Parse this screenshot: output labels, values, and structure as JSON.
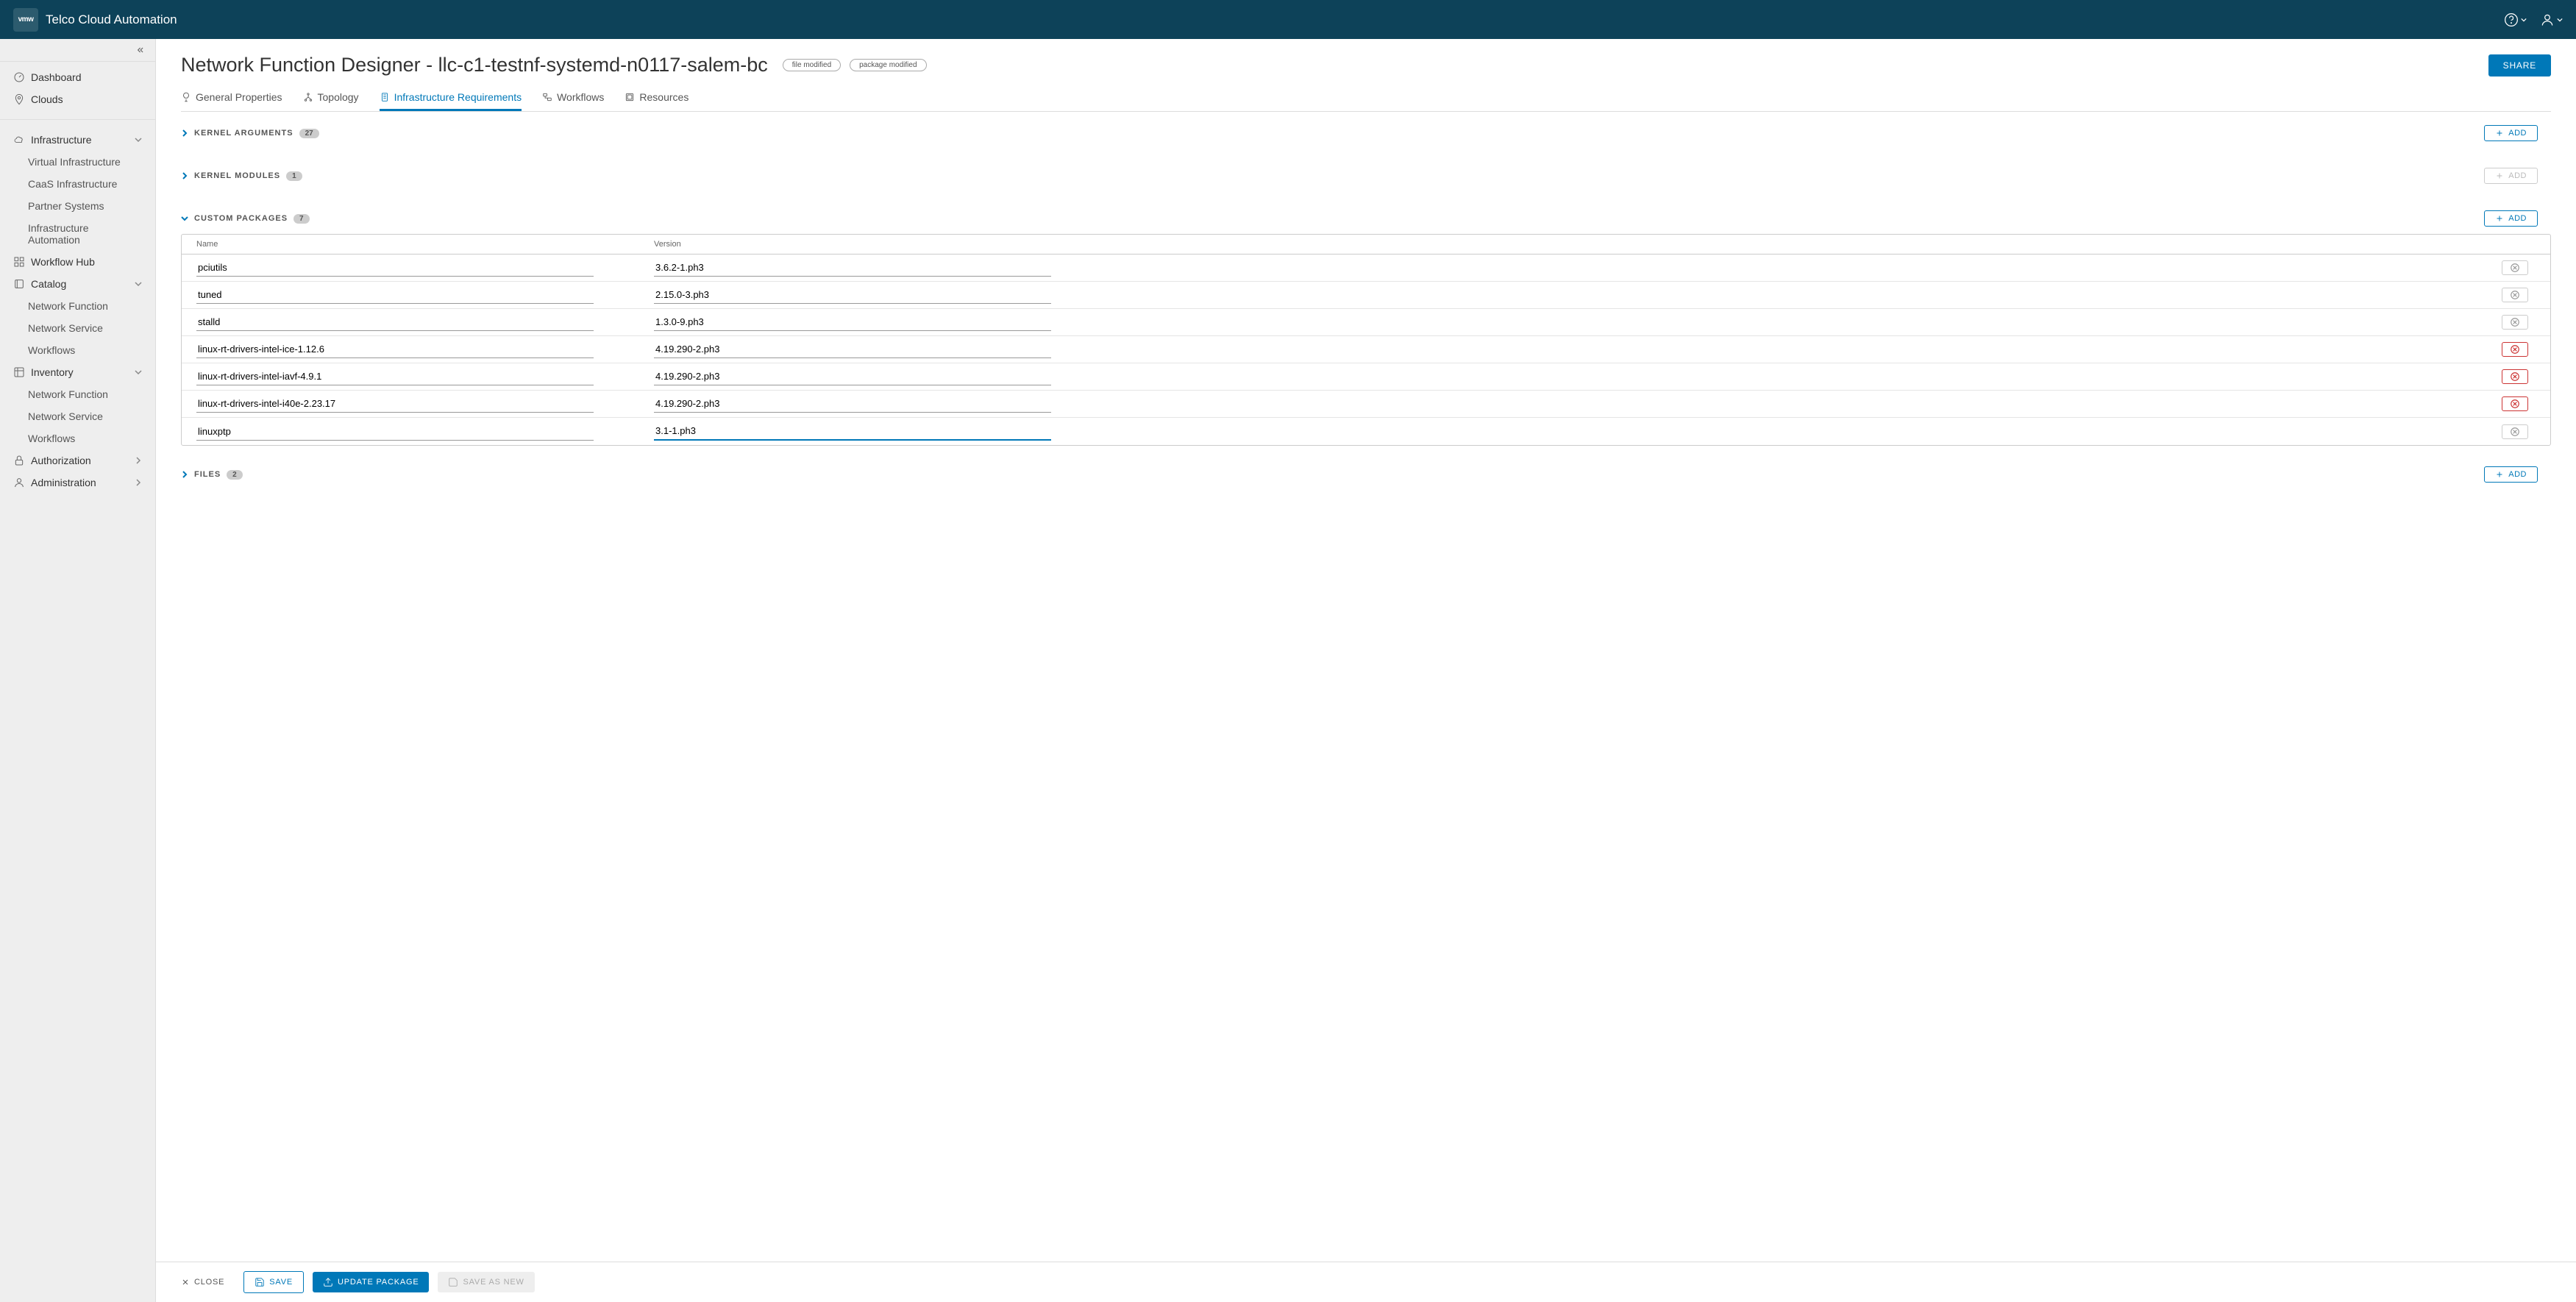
{
  "header": {
    "logo": "vmw",
    "title": "Telco Cloud Automation"
  },
  "sidebar": {
    "top": [
      {
        "label": "Dashboard",
        "icon": "gauge"
      },
      {
        "label": "Clouds",
        "icon": "pin"
      }
    ],
    "infra": {
      "label": "Infrastructure",
      "items": [
        "Virtual Infrastructure",
        "CaaS Infrastructure",
        "Partner Systems",
        "Infrastructure Automation"
      ]
    },
    "workflowhub": {
      "label": "Workflow Hub"
    },
    "catalog": {
      "label": "Catalog",
      "items": [
        "Network Function",
        "Network Service",
        "Workflows"
      ]
    },
    "inventory": {
      "label": "Inventory",
      "items": [
        "Network Function",
        "Network Service",
        "Workflows"
      ]
    },
    "authorization": {
      "label": "Authorization"
    },
    "administration": {
      "label": "Administration"
    }
  },
  "page": {
    "title": "Network Function Designer - llc-c1-testnf-systemd-n0117-salem-bc",
    "badges": [
      "file modified",
      "package modified"
    ],
    "share": "SHARE"
  },
  "tabs": [
    {
      "label": "General Properties",
      "active": false
    },
    {
      "label": "Topology",
      "active": false
    },
    {
      "label": "Infrastructure Requirements",
      "active": true
    },
    {
      "label": "Workflows",
      "active": false
    },
    {
      "label": "Resources",
      "active": false
    }
  ],
  "sections": {
    "kernel_args": {
      "title": "KERNEL ARGUMENTS",
      "count": "27",
      "expanded": false,
      "addEnabled": true
    },
    "kernel_modules": {
      "title": "KERNEL MODULES",
      "count": "1",
      "expanded": false,
      "addEnabled": false
    },
    "custom_packages": {
      "title": "CUSTOM PACKAGES",
      "count": "7",
      "expanded": true,
      "addEnabled": true
    },
    "files": {
      "title": "FILES",
      "count": "2",
      "expanded": false,
      "addEnabled": true
    }
  },
  "packages_table": {
    "headers": {
      "name": "Name",
      "version": "Version"
    },
    "rows": [
      {
        "name": "pciutils",
        "version": "3.6.2-1.ph3",
        "redDelete": false
      },
      {
        "name": "tuned",
        "version": "2.15.0-3.ph3",
        "redDelete": false
      },
      {
        "name": "stalld",
        "version": "1.3.0-9.ph3",
        "redDelete": false
      },
      {
        "name": "linux-rt-drivers-intel-ice-1.12.6",
        "version": "4.19.290-2.ph3",
        "redDelete": true
      },
      {
        "name": "linux-rt-drivers-intel-iavf-4.9.1",
        "version": "4.19.290-2.ph3",
        "redDelete": true
      },
      {
        "name": "linux-rt-drivers-intel-i40e-2.23.17",
        "version": "4.19.290-2.ph3",
        "redDelete": true
      },
      {
        "name": "linuxptp",
        "version": "3.1-1.ph3",
        "redDelete": false,
        "activeRow": true
      }
    ]
  },
  "buttons": {
    "add": "ADD"
  },
  "footer": {
    "close": "CLOSE",
    "save": "SAVE",
    "update": "UPDATE PACKAGE",
    "saveAsNew": "SAVE AS NEW"
  }
}
